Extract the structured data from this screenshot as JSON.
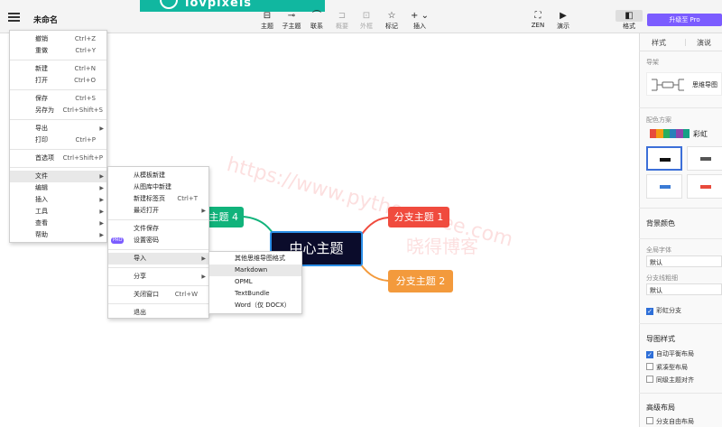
{
  "app": {
    "title": "未命名",
    "banner_text": "iovpixels"
  },
  "toolbar": [
    {
      "label": "主题",
      "icon": "subject-icon"
    },
    {
      "label": "子主题",
      "icon": "subtopic-icon"
    },
    {
      "label": "联系",
      "icon": "relationship-icon"
    },
    {
      "label": "概要",
      "icon": "summary-icon"
    },
    {
      "label": "外框",
      "icon": "boundary-icon"
    },
    {
      "label": "标记",
      "icon": "star-icon"
    },
    {
      "label": "插入",
      "icon": "plus-icon"
    },
    {
      "label": "ZEN",
      "icon": "fullscreen-icon"
    },
    {
      "label": "演示",
      "icon": "play-icon"
    },
    {
      "label": "格式",
      "icon": "format-panel-icon"
    }
  ],
  "panel": {
    "upgrade": "升级至 Pro",
    "tabs": [
      "样式",
      "演说"
    ],
    "structure_label": "导架",
    "structure_name": "思维导图",
    "color_label": "配色方案",
    "color_name": "彩虹",
    "swatch_colors": [
      "#e74c3c",
      "#f39c12",
      "#27ae60",
      "#2980b9",
      "#8e44ad",
      "#16a085"
    ],
    "bg_label": "背景颜色",
    "font_label": "全局字体",
    "font_value": "默认",
    "line_label": "分支线粗细",
    "line_value": "默认",
    "rainbow_branch": "彩虹分支",
    "layout_label": "导图样式",
    "layout_options": [
      "自动平衡布局",
      "紧凑型布局",
      "同级主题对齐"
    ],
    "advanced_label": "高级布局",
    "advanced_option": "分支自由布局"
  },
  "canvas": {
    "central": "中心主题",
    "branch1": "分支主题 1",
    "branch2": "分支主题 2",
    "branch4": "主题 4",
    "watermark1": "https://www.pythonthree.com",
    "watermark2": "晓得博客"
  },
  "main_menu": {
    "items": [
      {
        "label": "撤销",
        "shortcut": "Ctrl+Z"
      },
      {
        "label": "重做",
        "shortcut": "Ctrl+Y"
      },
      {
        "label": "新建",
        "shortcut": "Ctrl+N"
      },
      {
        "label": "打开",
        "shortcut": "Ctrl+O"
      },
      {
        "label": "保存",
        "shortcut": "Ctrl+S"
      },
      {
        "label": "另存为",
        "shortcut": "Ctrl+Shift+S"
      },
      {
        "label": "导出",
        "shortcut": ""
      },
      {
        "label": "打印",
        "shortcut": "Ctrl+P"
      },
      {
        "label": "首选项",
        "shortcut": "Ctrl+Shift+P"
      },
      {
        "label": "文件",
        "shortcut": ""
      },
      {
        "label": "编辑",
        "shortcut": ""
      },
      {
        "label": "插入",
        "shortcut": ""
      },
      {
        "label": "工具",
        "shortcut": ""
      },
      {
        "label": "查看",
        "shortcut": ""
      },
      {
        "label": "帮助",
        "shortcut": ""
      }
    ]
  },
  "file_menu": {
    "items": [
      {
        "label": "从模板新建",
        "shortcut": ""
      },
      {
        "label": "从图库中新建",
        "shortcut": ""
      },
      {
        "label": "新建标签页",
        "shortcut": "Ctrl+T"
      },
      {
        "label": "最近打开",
        "shortcut": ""
      },
      {
        "label": "文件保存",
        "shortcut": ""
      },
      {
        "label": "设置密码",
        "shortcut": ""
      },
      {
        "label": "导入",
        "shortcut": ""
      },
      {
        "label": "分享",
        "shortcut": ""
      },
      {
        "label": "关闭窗口",
        "shortcut": "Ctrl+W"
      },
      {
        "label": "退出",
        "shortcut": ""
      }
    ],
    "pro_badge": "PRO"
  },
  "import_menu": {
    "items": [
      "其他思维导图格式",
      "Markdown",
      "OPML",
      "TextBundle",
      "Word（仅 DOCX）"
    ]
  }
}
